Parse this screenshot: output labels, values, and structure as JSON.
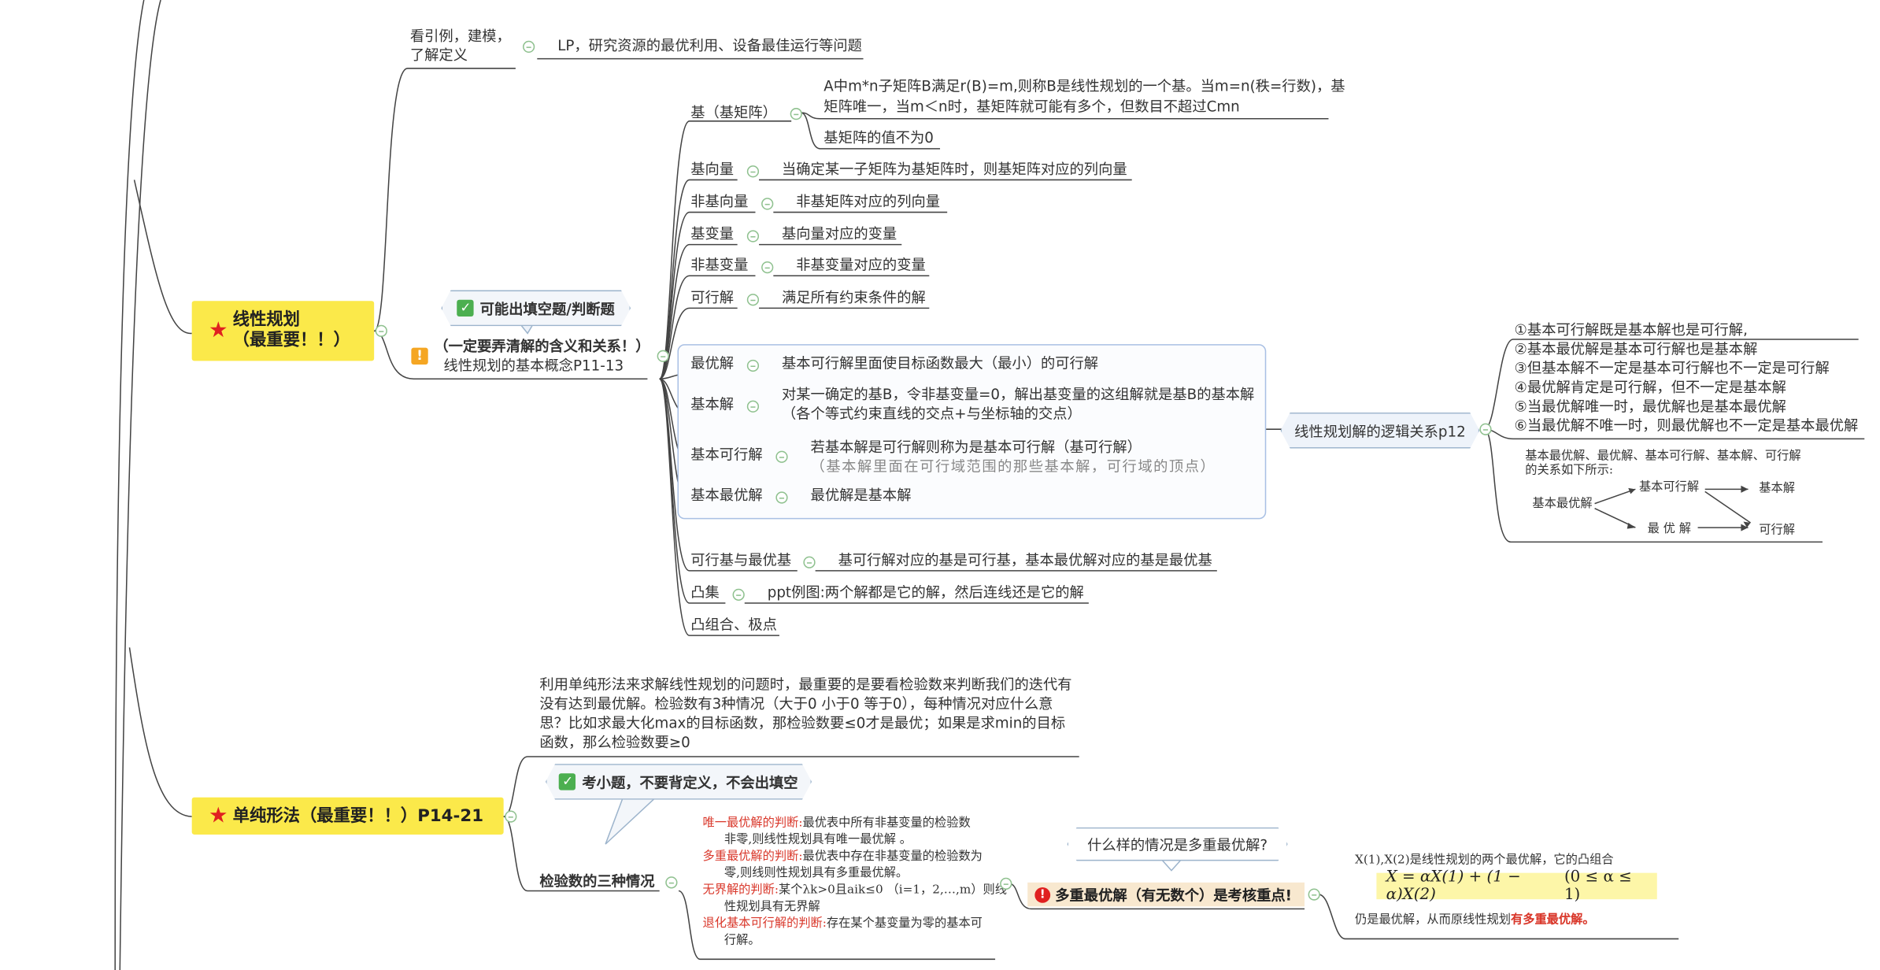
{
  "topic1": {
    "title_line1": "线性规划",
    "title_line2": "（最重要！！）",
    "intro_label": "看引例，建模，\n了解定义",
    "intro_detail": "LP，研究资源的最优利用、设备最佳运行等问题",
    "callout": "可能出填空题/判断题",
    "concept_warn": "（一定要弄清解的含义和关系！）",
    "concept_label": "线性规划的基本概念P11-13",
    "items": [
      {
        "name": "基（基矩阵）",
        "detail": "A中m*n子矩阵B满足r(B)=m,则称B是线性规划的一个基。当m=n(秩=行数)，基矩阵唯一，当m＜n时，基矩阵就可能有多个，但数目不超过Cmn",
        "detail2": "基矩阵的值不为0"
      },
      {
        "name": "基向量",
        "detail": "当确定某一子矩阵为基矩阵时，则基矩阵对应的列向量"
      },
      {
        "name": "非基向量",
        "detail": "非基矩阵对应的列向量"
      },
      {
        "name": "基变量",
        "detail": "基向量对应的变量"
      },
      {
        "name": "非基变量",
        "detail": "非基变量对应的变量"
      },
      {
        "name": "可行解",
        "detail": "满足所有约束条件的解"
      },
      {
        "name": "最优解",
        "detail": "基本可行解里面使目标函数最大（最小）的可行解"
      },
      {
        "name": "基本解",
        "detail": "对某一确定的基B，令非基变量=0，解出基变量的这组解就是基B的基本解",
        "detail2": "（各个等式约束直线的交点+与坐标轴的交点）"
      },
      {
        "name": "基本可行解",
        "detail": "若基本解是可行解则称为是基本可行解（基可行解）",
        "detail2": "（基本解里面在可行域范围的那些基本解，可行域的顶点）"
      },
      {
        "name": "基本最优解",
        "detail": "最优解是基本解"
      },
      {
        "name": "可行基与最优基",
        "detail": "基可行解对应的基是可行基，基本最优解对应的基是最优基"
      },
      {
        "name": "凸集",
        "detail": "ppt例图:两个解都是它的解，然后连线还是它的解"
      },
      {
        "name": "凸组合、极点",
        "detail": ""
      }
    ],
    "relation_label": "线性规划解的逻辑关系p12",
    "relations": [
      "①基本可行解既是基本解也是可行解,",
      "②基本最优解是基本可行解也是基本解",
      "③但基本解不一定是基本可行解也不一定是可行解",
      "④最优解肯定是可行解，但不一定是基本解",
      "⑤当最优解唯一时，最优解也是基本最优解",
      "⑥当最优解不唯一时，则最优解也不一定是基本最优解"
    ],
    "diagram": {
      "caption_line1": "基本最优解、最优解、基本可行解、基本解、可行解",
      "caption_line2": "的关系如下所示:",
      "n_best_basic": "基本最优解",
      "n_basic_feasible": "基本可行解",
      "n_basic": "基本解",
      "n_optimal": "最 优 解",
      "n_feasible": "可行解"
    }
  },
  "topic2": {
    "title": "单纯形法（最重要！！）P14-21",
    "intro": "利用单纯形法来求解线性规划的问题时，最重要的是要看检验数来判断我们的迭代有没有达到最优解。检验数有3种情况（大于0 小于0 等于0），每种情况对应什么意思？比如求最大化max的目标函数，那检验数要≤0才是最优；如果是求min的目标函数，那么检验数要≥0",
    "callout": "考小题，不要背定义，不会出填空",
    "check_label": "检验数的三种情况",
    "cases": [
      {
        "title": "唯一最优解的判断:",
        "text": "最优表中所有非基变量的检验数",
        "text2": "非零,则线性规划具有唯一最优解 。"
      },
      {
        "title": "多重最优解的判断:",
        "text": "最优表中存在非基变量的检验数为",
        "text2": "零,则线则性规划具有多重最优解。"
      },
      {
        "title": "无界解的判断:",
        "text": "某个λk>0且aik≤0 （i=1，2,…,m）则线",
        "text2": "性规划具有无界解"
      },
      {
        "title": "退化基本可行解的判断:",
        "text": "存在某个基变量为零的基本可",
        "text2": "行解。"
      }
    ],
    "question": "什么样的情况是多重最优解?",
    "key_point": "多重最优解（有无数个）是考核重点!",
    "key_icon": "!",
    "conv_line1": "X(1),X(2)是线性规划的两个最优解，它的凸组合",
    "formula": "X = αX(1) + (1 − α)X(2)",
    "formula_range": "(0 ≤ α ≤ 1)",
    "conv_line3_a": "仍是最优解，从而原线性规划",
    "conv_line3_b": "有多重最优解。"
  },
  "colors": {
    "main_topic_bg": "#fbe94a",
    "line": "#444444",
    "accent_red": "#d9372a",
    "fold_green": "#8fc18f"
  }
}
